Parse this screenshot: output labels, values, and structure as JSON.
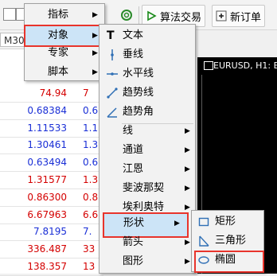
{
  "toolbar": {
    "algo_trading_label": "算法交易",
    "new_order_label": "新订单"
  },
  "watch": {
    "timeframe_label": "M30",
    "rows": [
      {
        "v1": "74.94",
        "v1c": "red",
        "v2": "7",
        "v2c": "red"
      },
      {
        "v1": "0.68384",
        "v1c": "blue",
        "v2": "0.6",
        "v2c": "blue"
      },
      {
        "v1": "1.11533",
        "v1c": "blue",
        "v2": "1.1",
        "v2c": "blue"
      },
      {
        "v1": "1.30461",
        "v1c": "blue",
        "v2": "1.3",
        "v2c": "blue"
      },
      {
        "v1": "0.63494",
        "v1c": "blue",
        "v2": "0.6",
        "v2c": "blue"
      },
      {
        "v1": "1.31577",
        "v1c": "red",
        "v2": "1.3",
        "v2c": "red"
      },
      {
        "v1": "0.86300",
        "v1c": "red",
        "v2": "0.8",
        "v2c": "red"
      },
      {
        "v1": "6.67963",
        "v1c": "red",
        "v2": "6.6",
        "v2c": "red"
      },
      {
        "v1": "7.8195",
        "v1c": "blue",
        "v2": "7.",
        "v2c": "blue"
      },
      {
        "v1": "336.487",
        "v1c": "red",
        "v2": "33",
        "v2c": "red"
      },
      {
        "v1": "138.357",
        "v1c": "red",
        "v2": "13",
        "v2c": "red"
      }
    ]
  },
  "chart": {
    "title": "EURUSD, H1: E"
  },
  "menu_main": {
    "items": [
      {
        "label": "指标"
      },
      {
        "label": "对象"
      },
      {
        "label": "专家"
      },
      {
        "label": "脚本"
      }
    ]
  },
  "menu_objects": {
    "items": [
      {
        "label": "文本",
        "icon": "text-icon"
      },
      {
        "label": "垂线",
        "icon": "vertical-line-icon"
      },
      {
        "label": "水平线",
        "icon": "horizontal-line-icon"
      },
      {
        "label": "趋势线",
        "icon": "trendline-icon"
      },
      {
        "label": "趋势角",
        "icon": "trend-angle-icon"
      },
      {
        "label": "线"
      },
      {
        "label": "通道"
      },
      {
        "label": "江恩"
      },
      {
        "label": "斐波那契"
      },
      {
        "label": "埃利奥特"
      },
      {
        "label": "形状"
      },
      {
        "label": "箭头"
      },
      {
        "label": "图形"
      }
    ]
  },
  "menu_shapes": {
    "items": [
      {
        "label": "矩形",
        "icon": "rectangle-icon"
      },
      {
        "label": "三角形",
        "icon": "triangle-icon"
      },
      {
        "label": "椭圆",
        "icon": "ellipse-icon"
      }
    ]
  }
}
